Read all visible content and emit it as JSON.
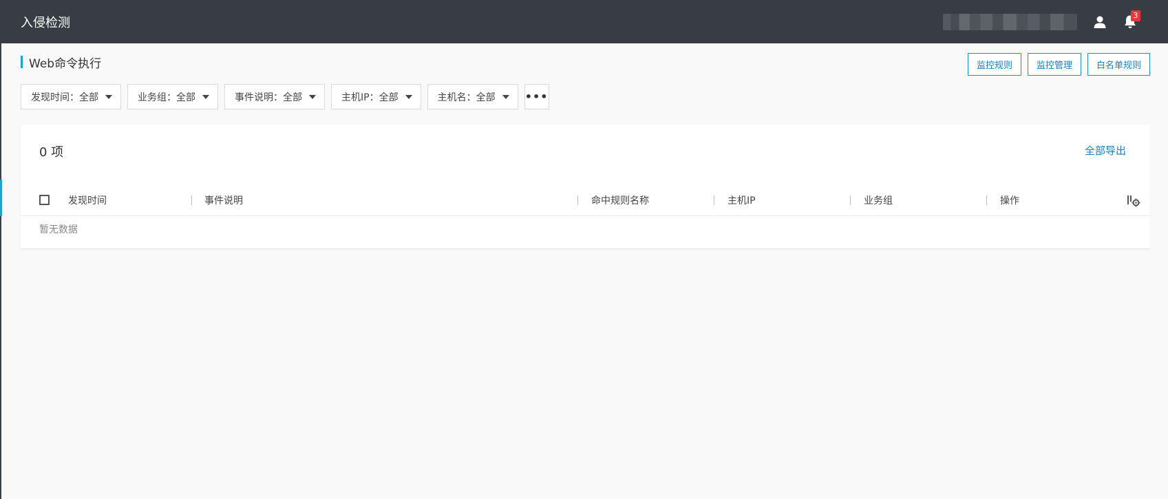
{
  "app": {
    "title": "入侵检测"
  },
  "header": {
    "notification_count": "3",
    "user_icon": "user-icon",
    "bell_icon": "bell-icon"
  },
  "page": {
    "title": "Web命令执行",
    "actions": [
      "监控规则",
      "监控管理",
      "白名单规则"
    ]
  },
  "filters": [
    {
      "label": "发现时间：全部"
    },
    {
      "label": "业务组：全部"
    },
    {
      "label": "事件说明：全部"
    },
    {
      "label": "主机IP：全部"
    },
    {
      "label": "主机名：全部"
    }
  ],
  "more_label": "•••",
  "table": {
    "count_label": "0 项",
    "export_label": "全部导出",
    "columns": [
      "发现时间",
      "事件说明",
      "命中规则名称",
      "主机IP",
      "业务组",
      "操作"
    ],
    "empty_text": "暂无数据"
  },
  "colors": {
    "topbar": "#383d45",
    "accent": "#1aa5cc",
    "link": "#1a7fbf",
    "badge": "#e03b3b"
  }
}
